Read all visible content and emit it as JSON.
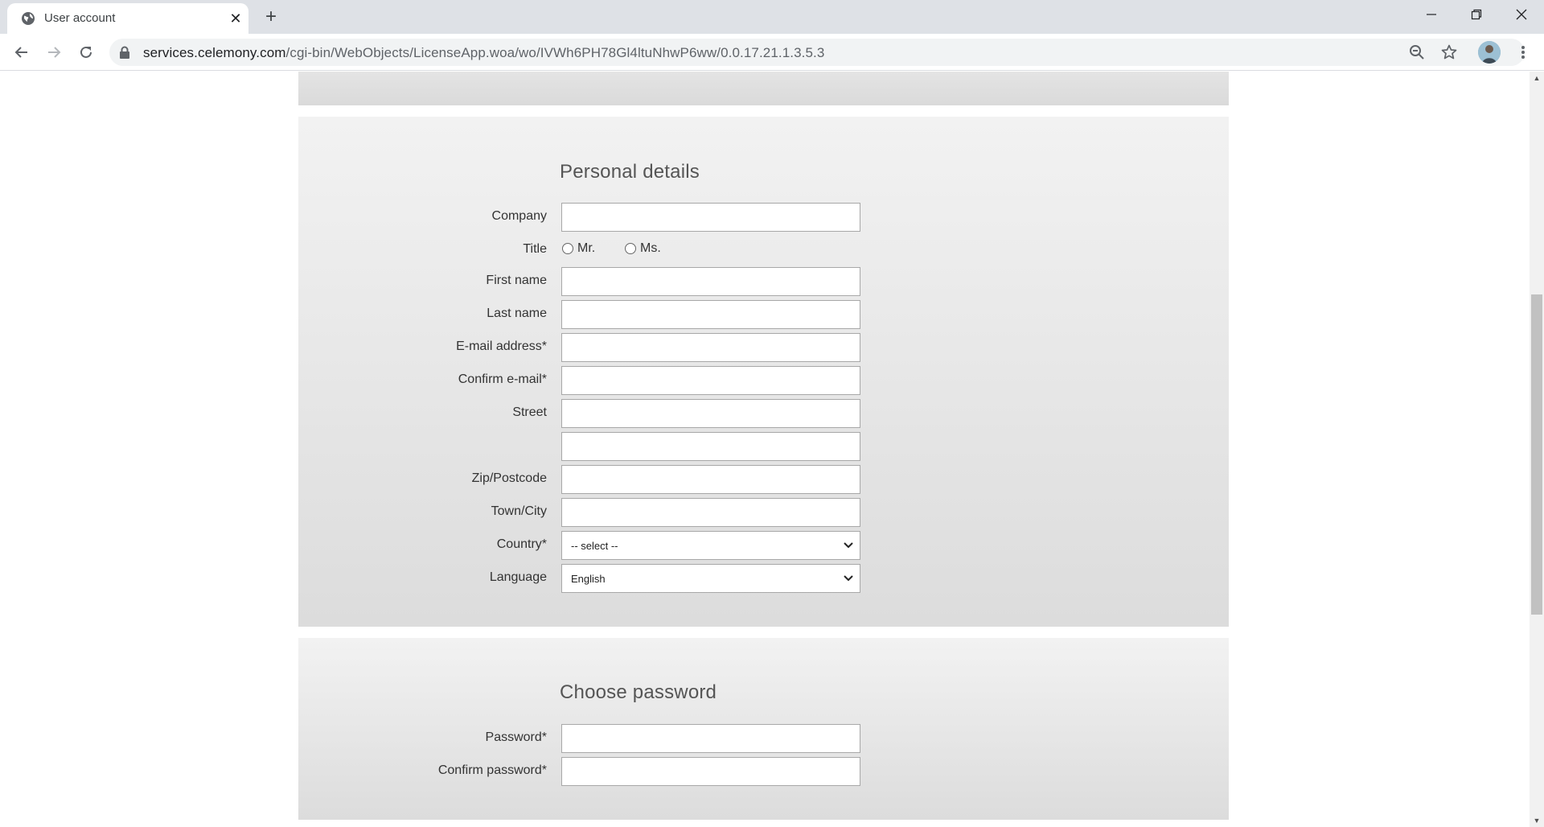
{
  "browser": {
    "tab_title": "User account",
    "url_host": "services.celemony.com",
    "url_path": "/cgi-bin/WebObjects/LicenseApp.woa/wo/IVWh6PH78Gl4ltuNhwP6ww/0.0.17.21.1.3.5.3",
    "tab_close": "✕",
    "new_tab": "+"
  },
  "personal": {
    "title": "Personal details",
    "company_label": "Company",
    "title_label": "Title",
    "mr_label": "Mr.",
    "ms_label": "Ms.",
    "first_name_label": "First name",
    "last_name_label": "Last name",
    "email_label": "E-mail address*",
    "confirm_email_label": "Confirm e-mail*",
    "street_label": "Street",
    "zip_label": "Zip/Postcode",
    "town_label": "Town/City",
    "country_label": "Country*",
    "country_value": "-- select --",
    "language_label": "Language",
    "language_value": "English"
  },
  "password": {
    "title": "Choose password",
    "password_label": "Password*",
    "confirm_password_label": "Confirm password*"
  },
  "icons": {
    "back": "back-arrow-icon",
    "forward": "forward-arrow-icon",
    "reload": "reload-icon",
    "lock": "lock-icon",
    "zoom": "zoom-out-icon",
    "star": "bookmark-star-icon",
    "menu": "more-vert-icon"
  }
}
